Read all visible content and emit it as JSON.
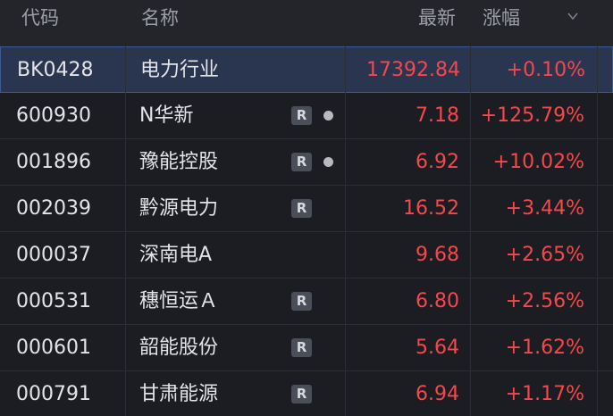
{
  "header": {
    "code": "代码",
    "name": "名称",
    "price": "最新",
    "change": "涨幅"
  },
  "rows": [
    {
      "code": "BK0428",
      "name": "电力行业",
      "price": "17392.84",
      "change": "+0.10%",
      "badge": "",
      "dot": false,
      "selected": true
    },
    {
      "code": "600930",
      "name": "N华新",
      "price": "7.18",
      "change": "+125.79%",
      "badge": "R",
      "dot": true,
      "selected": false
    },
    {
      "code": "001896",
      "name": "豫能控股",
      "price": "6.92",
      "change": "+10.02%",
      "badge": "R",
      "dot": true,
      "selected": false
    },
    {
      "code": "002039",
      "name": "黔源电力",
      "price": "16.52",
      "change": "+3.44%",
      "badge": "R",
      "dot": false,
      "selected": false
    },
    {
      "code": "000037",
      "name": "深南电A",
      "price": "9.68",
      "change": "+2.65%",
      "badge": "",
      "dot": false,
      "selected": false
    },
    {
      "code": "000531",
      "name": "穗恒运Ａ",
      "price": "6.80",
      "change": "+2.56%",
      "badge": "R",
      "dot": false,
      "selected": false
    },
    {
      "code": "000601",
      "name": "韶能股份",
      "price": "5.64",
      "change": "+1.62%",
      "badge": "R",
      "dot": false,
      "selected": false
    },
    {
      "code": "000791",
      "name": "甘肃能源",
      "price": "6.94",
      "change": "+1.17%",
      "badge": "R",
      "dot": false,
      "selected": false
    }
  ],
  "colors": {
    "up": "#f5484d",
    "background": "#1c1d22",
    "selected_row": "#2a3550",
    "badge": "#4a4e58"
  },
  "icons": {
    "sort": "chevron-down-icon",
    "tag": "r-badge-icon",
    "status": "dot-icon"
  }
}
